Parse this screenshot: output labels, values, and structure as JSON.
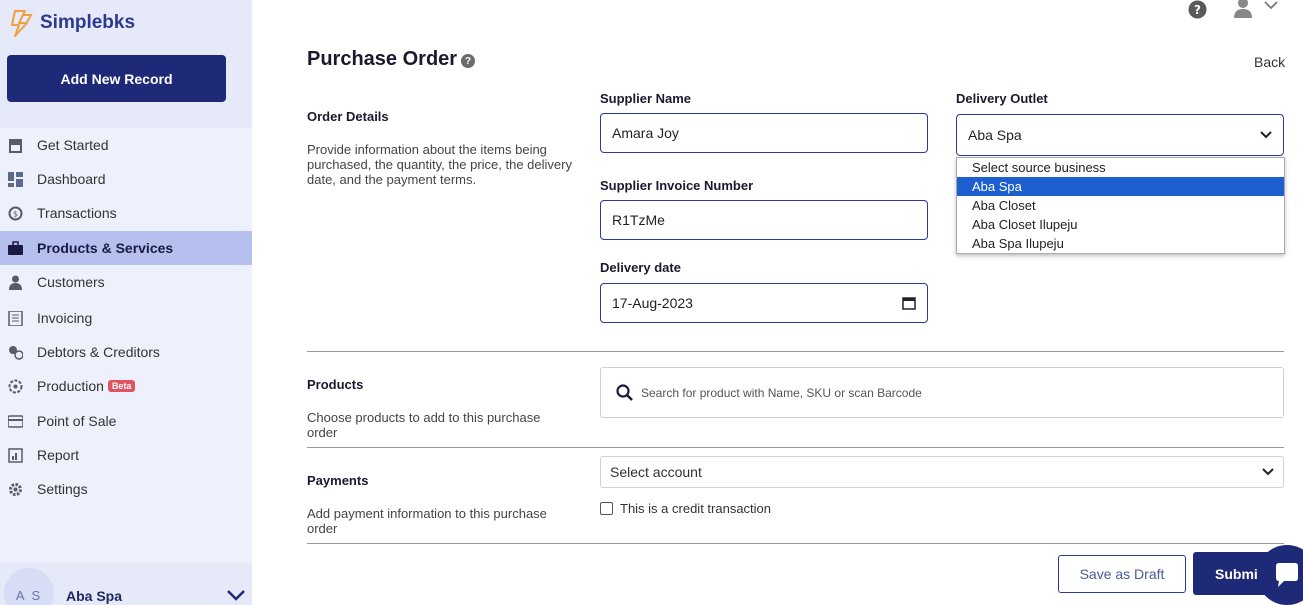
{
  "brand": {
    "name": "Simplebks"
  },
  "sidebar": {
    "add_button": "Add New Record",
    "items": [
      {
        "label": "Get Started",
        "icon": "store-icon"
      },
      {
        "label": "Dashboard",
        "icon": "dashboard-icon"
      },
      {
        "label": "Transactions",
        "icon": "transactions-icon"
      },
      {
        "label": "Products & Services",
        "icon": "briefcase-icon",
        "active": true
      },
      {
        "label": "Customers",
        "icon": "person-icon"
      },
      {
        "label": "Invoicing",
        "icon": "invoice-icon"
      },
      {
        "label": "Debtors & Creditors",
        "icon": "debtors-icon"
      },
      {
        "label": "Production",
        "icon": "production-icon",
        "badge": "Beta"
      },
      {
        "label": "Point of Sale",
        "icon": "card-icon"
      },
      {
        "label": "Report",
        "icon": "report-icon"
      },
      {
        "label": "Settings",
        "icon": "gear-icon"
      }
    ],
    "user": {
      "initials": "A S",
      "name": "Aba Spa"
    }
  },
  "header": {
    "title": "Purchase Order",
    "help": "?",
    "back": "Back"
  },
  "order_details": {
    "title": "Order Details",
    "description": "Provide information about the items being purchased, the quantity, the price, the delivery date, and the payment terms.",
    "supplier_name_label": "Supplier Name",
    "supplier_name_value": "Amara Joy",
    "delivery_outlet_label": "Delivery Outlet",
    "delivery_outlet_value": "Aba Spa",
    "invoice_number_label": "Supplier Invoice Number",
    "invoice_number_value": "R1TzMe",
    "delivery_date_label": "Delivery date",
    "delivery_date_value": "17-Aug-2023"
  },
  "outlet_dropdown": {
    "options": [
      "Select source business",
      "Aba Spa",
      "Aba Closet",
      "Aba Closet Ilupeju",
      "Aba Spa Ilupeju"
    ],
    "selected_index": 1
  },
  "products": {
    "title": "Products",
    "description": "Choose products to add to this purchase order",
    "search_placeholder": "Search for product with Name, SKU or scan Barcode"
  },
  "payments": {
    "title": "Payments",
    "description": "Add payment information to this purchase order",
    "account_select": "Select account",
    "credit_label": "This is a credit transaction"
  },
  "actions": {
    "save_draft": "Save as Draft",
    "submit": "Submit"
  },
  "colors": {
    "primary": "#1e2a78",
    "active_nav": "#b5c0ee",
    "sidebar_bg": "#eef1fb",
    "beta": "#e05260",
    "selected_option": "#1e5fd0"
  }
}
